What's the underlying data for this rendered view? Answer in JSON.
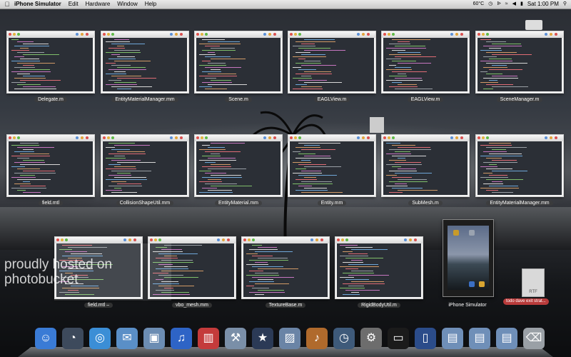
{
  "menubar": {
    "app_name": "iPhone Simulator",
    "items": [
      "Edit",
      "Hardware",
      "Window",
      "Help"
    ],
    "temperature": "60°C",
    "clock": "Sat 1:00 PM"
  },
  "windows": [
    {
      "label": "Delegate.m"
    },
    {
      "label": "EntityMaterialManager.mm"
    },
    {
      "label": "Scene.m"
    },
    {
      "label": "EAGLView.m"
    },
    {
      "label": "EAGLView.m"
    },
    {
      "label": "SceneManager.m"
    },
    {
      "label": "field.mtl"
    },
    {
      "label": "CollisionShapeUtil.mm"
    },
    {
      "label": "EntityMaterial.mm"
    },
    {
      "label": "Entity.mm"
    },
    {
      "label": "SubMesh.m"
    },
    {
      "label": "EntityMaterialManager.mm"
    },
    {
      "label": "field.mtl –"
    },
    {
      "label": "vbo_mesh.mm"
    },
    {
      "label": "TextureBase.m"
    },
    {
      "label": "RigidBodyUtil.m"
    }
  ],
  "simulator": {
    "label": "iPhone Simulator"
  },
  "file": {
    "type": "RTF",
    "label": "todo dave exit strat..."
  },
  "watermark": {
    "line1": "proudly hosted on",
    "line2": "photobucket"
  },
  "dock_icons": [
    "finder-icon",
    "dashboard-icon",
    "safari-icon",
    "mail-icon",
    "preview-icon",
    "itunes-icon",
    "parallels-icon",
    "xcode-icon",
    "imovie-icon",
    "iphoto-icon",
    "garageband-icon",
    "time-machine-icon",
    "system-preferences-icon",
    "terminal-icon",
    "iphone-simulator-icon",
    "applications-folder-icon",
    "documents-folder-icon",
    "downloads-folder-icon",
    "trash-icon"
  ]
}
